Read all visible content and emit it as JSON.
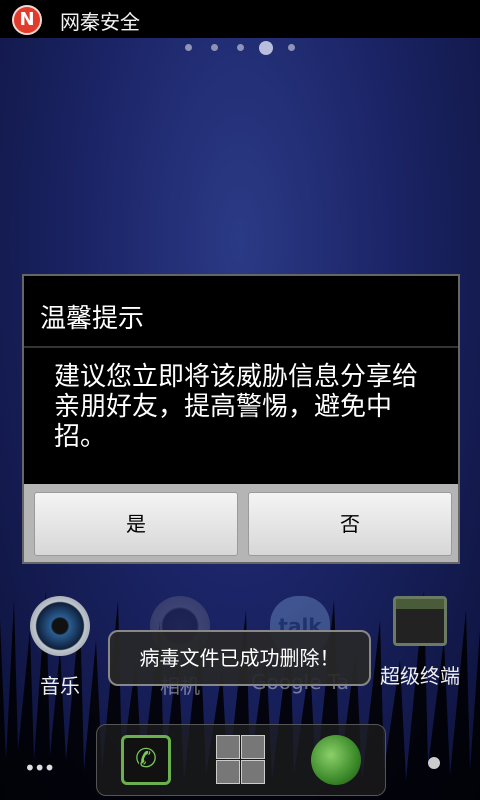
{
  "status_bar": {
    "app_name": "网秦安全",
    "app_icon": "N"
  },
  "page_indicator": {
    "count": 5,
    "active_index": 3
  },
  "dialog": {
    "title": "温馨提示",
    "message": "建议您立即将该威胁信息分享给亲朋好友，提高警惕，避免中招。",
    "buttons": {
      "yes": "是",
      "no": "否"
    }
  },
  "home_icons": [
    {
      "label": "音乐",
      "icon": "music-icon"
    },
    {
      "label": "相机",
      "icon": "camera-icon"
    },
    {
      "label": "Google Ta",
      "icon": "talk-icon",
      "glyph": "talk"
    },
    {
      "label": "超级终端",
      "icon": "terminal-icon"
    }
  ],
  "toast": {
    "text": "病毒文件已成功删除！"
  },
  "dock": {
    "items": [
      "phone-icon",
      "app-grid-icon",
      "browser-icon"
    ],
    "more": "•••"
  }
}
